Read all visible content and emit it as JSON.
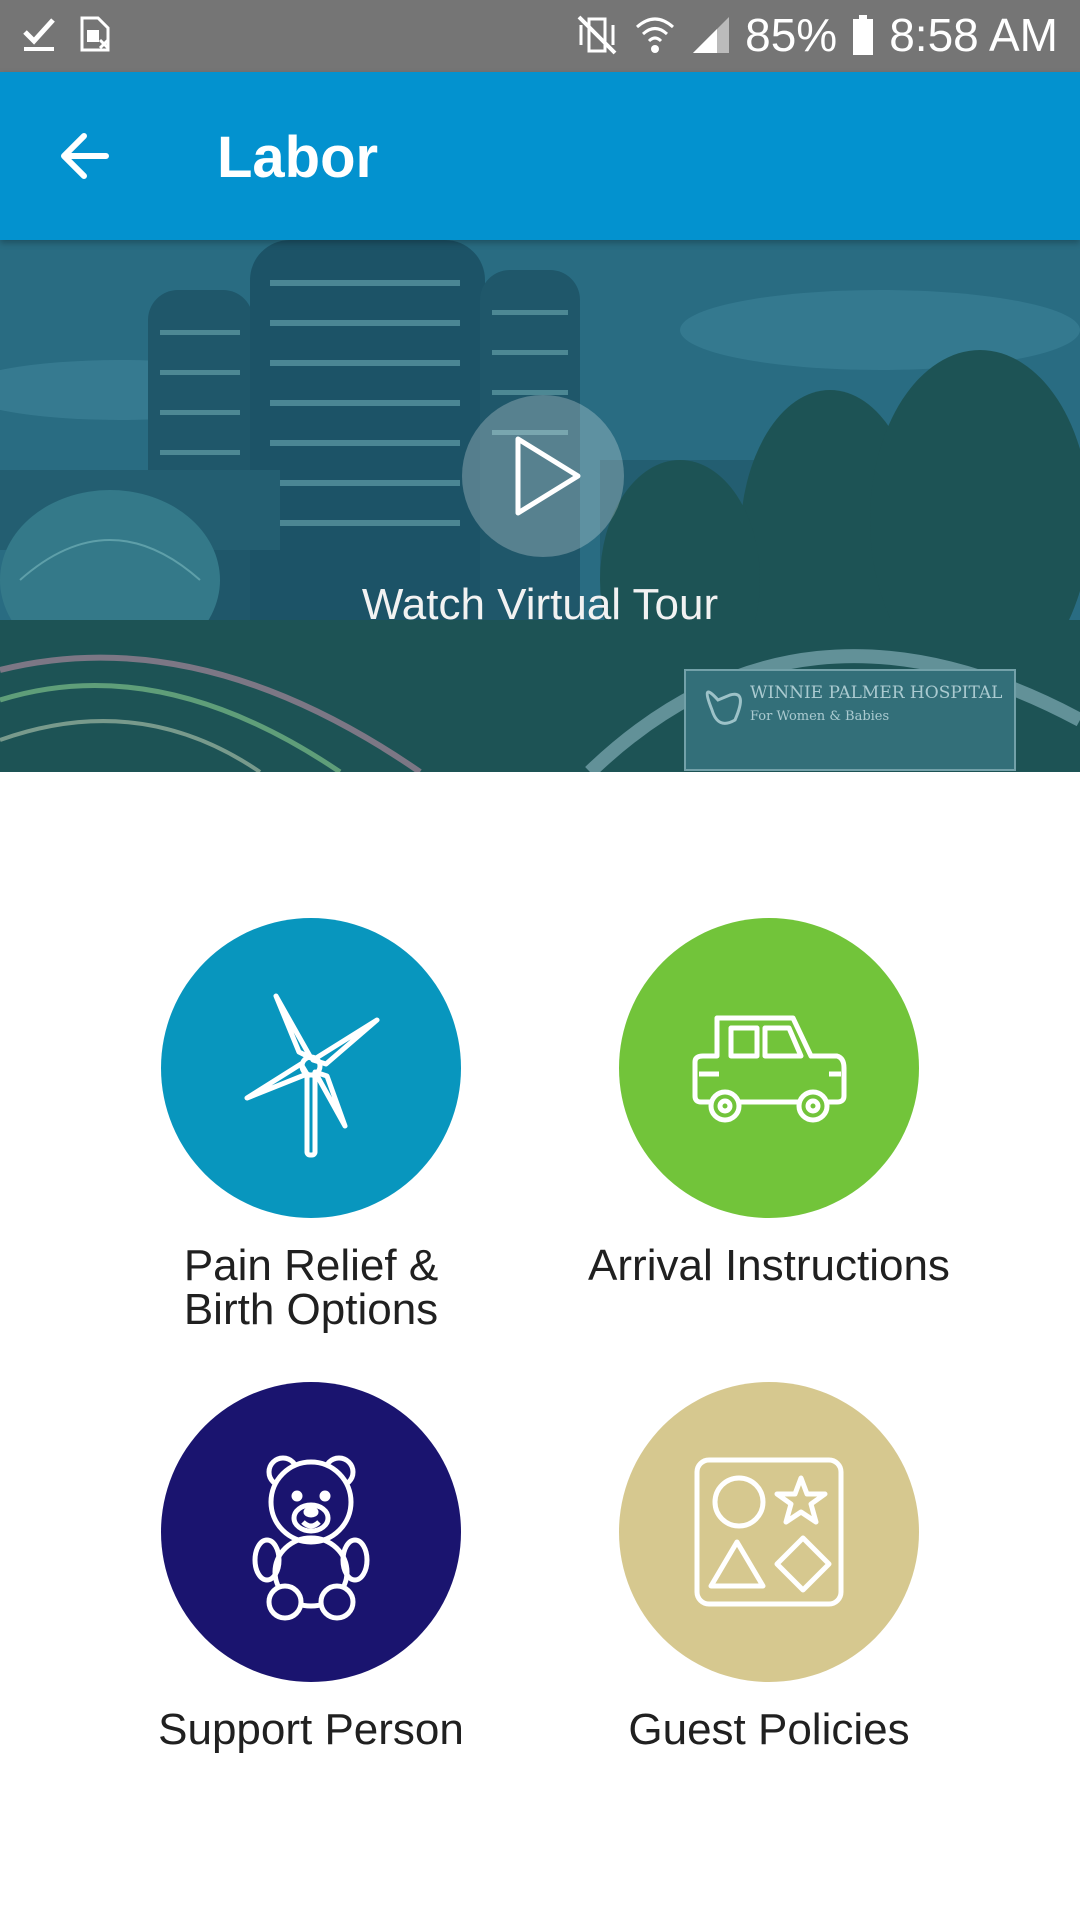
{
  "status_bar": {
    "battery": "85%",
    "time": "8:58 AM"
  },
  "app_bar": {
    "title": "Labor"
  },
  "hero": {
    "watch_label": "Watch Virtual Tour",
    "sign_line1": "WINNIE PALMER HOSPITAL",
    "sign_line2": "For Women & Babies"
  },
  "tiles": [
    {
      "label": "Pain Relief &\nBirth Options",
      "color": "#0896be",
      "icon": "pinwheel-icon"
    },
    {
      "label": "Arrival Instructions",
      "color": "#72c43a",
      "icon": "car-icon"
    },
    {
      "label": "Support Person",
      "color": "#1a146f",
      "icon": "teddy-bear-icon"
    },
    {
      "label": "Guest Policies",
      "color": "#d6c88f",
      "icon": "shapes-puzzle-icon"
    }
  ]
}
